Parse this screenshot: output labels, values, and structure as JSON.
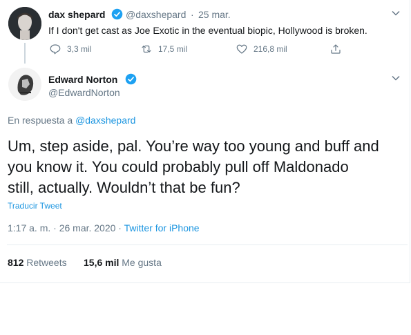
{
  "quoted": {
    "name": "dax shepard",
    "handle": "@daxshepard",
    "sep": "·",
    "date": "25 mar.",
    "text": "If I don't get cast as Joe Exotic in the eventual biopic, Hollywood is broken.",
    "replies": "3,3 mil",
    "retweets": "17,5 mil",
    "likes": "216,8 mil"
  },
  "tweet": {
    "name": "Edward Norton",
    "handle": "@EdwardNorton",
    "reply_prefix": "En respuesta a",
    "reply_to": "@daxshepard",
    "text_lines": [
      "Um, step aside, pal. You’re way too young and buff and",
      "you know it. You could probably pull off Maldonado",
      "still, actually. Wouldn’t that be fun?"
    ],
    "translate": "Traducir Tweet",
    "time": "1:17 a. m. · 26 mar. 2020 ·",
    "source": "Twitter for iPhone",
    "retweets_count": "812",
    "retweets_label": "Retweets",
    "likes_count": "15,6 mil",
    "likes_label": "Me gusta"
  },
  "colors": {
    "accent": "#1da1f2",
    "link": "#1b95e0",
    "muted": "#657786",
    "border": "#e6ecf0"
  }
}
